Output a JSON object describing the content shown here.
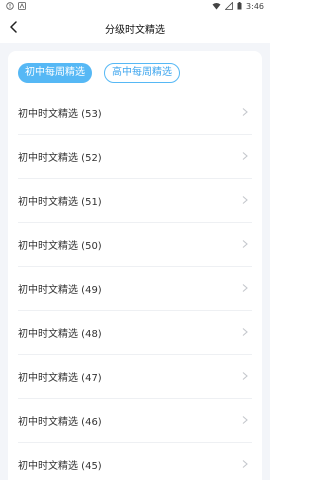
{
  "status_bar": {
    "time": "3:46"
  },
  "header": {
    "title": "分级时文精选"
  },
  "tabs": [
    {
      "label": "初中每周精选",
      "active": true
    },
    {
      "label": "高中每周精选",
      "active": false
    }
  ],
  "list": [
    {
      "label": "初中时文精选 (53)"
    },
    {
      "label": "初中时文精选 (52)"
    },
    {
      "label": "初中时文精选 (51)"
    },
    {
      "label": "初中时文精选 (50)"
    },
    {
      "label": "初中时文精选 (49)"
    },
    {
      "label": "初中时文精选 (48)"
    },
    {
      "label": "初中时文精选 (47)"
    },
    {
      "label": "初中时文精选 (46)"
    },
    {
      "label": "初中时文精选 (45)"
    }
  ],
  "colors": {
    "accent": "#56b8f5",
    "background": "#f3f5f9"
  }
}
